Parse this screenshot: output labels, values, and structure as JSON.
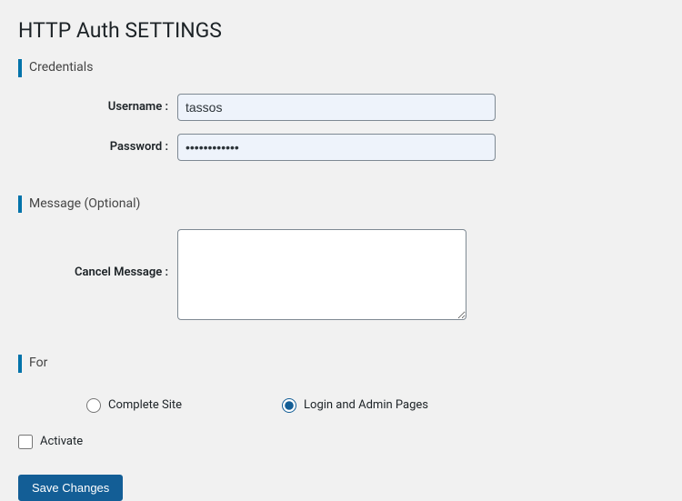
{
  "page_title": "HTTP Auth SETTINGS",
  "sections": {
    "credentials": {
      "heading": "Credentials",
      "username_label": "Username :",
      "username_value": "tassos",
      "password_label": "Password :",
      "password_value": "••••••••••••"
    },
    "message": {
      "heading": "Message (Optional)",
      "cancel_label": "Cancel Message :",
      "cancel_value": ""
    },
    "for": {
      "heading": "For",
      "option_complete": "Complete Site",
      "option_login": "Login and Admin Pages",
      "selected": "login"
    }
  },
  "activate_label": "Activate",
  "activate_checked": false,
  "save_label": "Save Changes"
}
